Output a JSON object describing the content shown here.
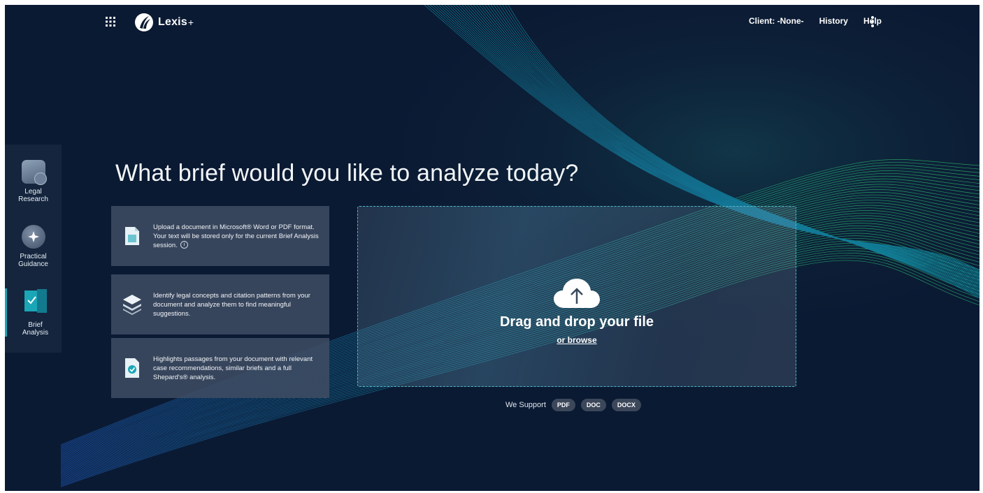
{
  "header": {
    "app_menu_icon": "grid-icon",
    "brand": "Lexis",
    "brand_suffix": "+",
    "client_label": "Client: -None-",
    "history": "History",
    "help": "Help",
    "more_icon": "vertical-dots-icon"
  },
  "rail": {
    "items": [
      {
        "line1": "Legal",
        "line2": "Research",
        "icon": "search-document-icon"
      },
      {
        "line1": "Practical",
        "line2": "Guidance",
        "icon": "compass-icon"
      },
      {
        "line1": "Brief",
        "line2": "Analysis",
        "icon": "checked-book-icon",
        "active": true
      }
    ]
  },
  "main": {
    "headline": "What brief would you like to analyze today?",
    "cards": [
      {
        "text": "Upload a document in Microsoft® Word or PDF format. Your text will be stored only for the current Brief Analysis session.",
        "icon": "document-icon"
      },
      {
        "text": "Identify legal concepts and citation patterns from your document and analyze them to find meaningful suggestions.",
        "icon": "layers-icon"
      },
      {
        "text": "Highlights passages from your document with relevant case recommendations, similar briefs and a full Shepard's® analysis.",
        "icon": "check-document-icon"
      }
    ],
    "dropzone": {
      "icon": "cloud-upload-icon",
      "title": "Drag and drop your file",
      "browse": "or browse"
    },
    "support": {
      "label": "We Support",
      "formats": [
        "PDF",
        "DOC",
        "DOCX"
      ]
    }
  },
  "colors": {
    "background": "#0b1a33",
    "accent": "#1aa6b7",
    "card": "#404e64"
  }
}
